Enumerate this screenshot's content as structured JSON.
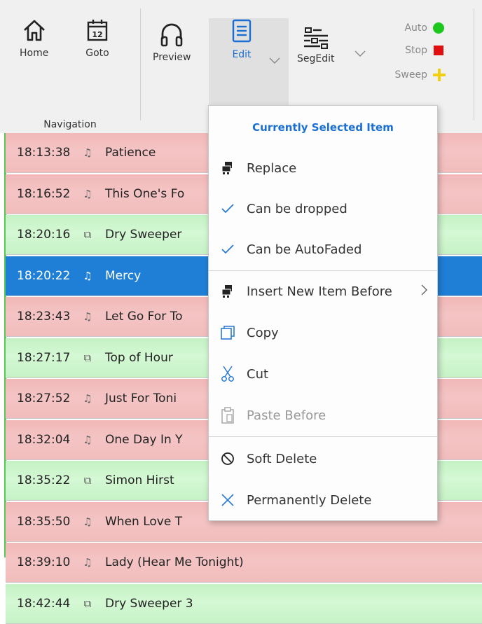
{
  "ribbon": {
    "buttons": [
      {
        "key": "home",
        "label": "Home",
        "icon": "home-icon"
      },
      {
        "key": "goto",
        "label": "Goto",
        "icon": "calendar-icon",
        "calendar_day": "12"
      },
      {
        "key": "preview",
        "label": "Preview",
        "icon": "headphones-icon"
      },
      {
        "key": "edit",
        "label": "Edit",
        "icon": "document-icon",
        "active": true
      },
      {
        "key": "segedit",
        "label": "SegEdit",
        "icon": "segments-icon"
      }
    ],
    "group_label": "Navigation",
    "controls": [
      {
        "label": "Auto",
        "color": "#1ec71e",
        "icon": "green-circle-icon"
      },
      {
        "label": "Stop",
        "color": "#e01010",
        "icon": "red-square-icon"
      },
      {
        "label": "Sweep",
        "color": "#f0d010",
        "icon": "yellow-plus-icon"
      }
    ]
  },
  "playlist": {
    "rows": [
      {
        "time": "18:13:38",
        "type": "song",
        "title": "Patience"
      },
      {
        "time": "18:16:52",
        "type": "song",
        "title": "This One's Fo"
      },
      {
        "time": "18:20:16",
        "type": "sweep",
        "title": "Dry Sweeper"
      },
      {
        "time": "18:20:22",
        "type": "song",
        "title": "Mercy",
        "selected": true
      },
      {
        "time": "18:23:43",
        "type": "song",
        "title": "Let Go For To"
      },
      {
        "time": "18:27:17",
        "type": "sweep",
        "title": "Top of Hour"
      },
      {
        "time": "18:27:52",
        "type": "song",
        "title": "Just For Toni"
      },
      {
        "time": "18:32:04",
        "type": "song",
        "title": "One Day In Y"
      },
      {
        "time": "18:35:22",
        "type": "sweep",
        "title": "Simon Hirst"
      },
      {
        "time": "18:35:50",
        "type": "song",
        "title": "When Love T"
      },
      {
        "time": "18:39:10",
        "type": "song",
        "title": "Lady (Hear Me Tonight)"
      },
      {
        "time": "18:42:44",
        "type": "sweep",
        "title": "Dry Sweeper 3"
      }
    ]
  },
  "context_menu": {
    "header": "Currently Selected Item",
    "items": [
      {
        "label": "Replace",
        "icon": "replace-icon"
      },
      {
        "label": "Can be dropped",
        "icon": "checkmark-icon"
      },
      {
        "label": "Can be AutoFaded",
        "icon": "checkmark-icon"
      },
      {
        "label": "Insert New Item Before",
        "icon": "insert-icon",
        "submenu": ">"
      },
      {
        "label": "Copy",
        "icon": "copy-icon"
      },
      {
        "label": "Cut",
        "icon": "scissors-icon"
      },
      {
        "label": "Paste Before",
        "icon": "clipboard-icon",
        "disabled": true
      },
      {
        "label": "Soft Delete",
        "icon": "prohibited-icon"
      },
      {
        "label": "Permanently Delete",
        "icon": "x-icon"
      }
    ]
  },
  "colors": {
    "accent": "#1a6fd1",
    "song_row": "#f4c0c0",
    "sweep_row": "#cff6cf",
    "selected_row": "#1f7fd6"
  }
}
